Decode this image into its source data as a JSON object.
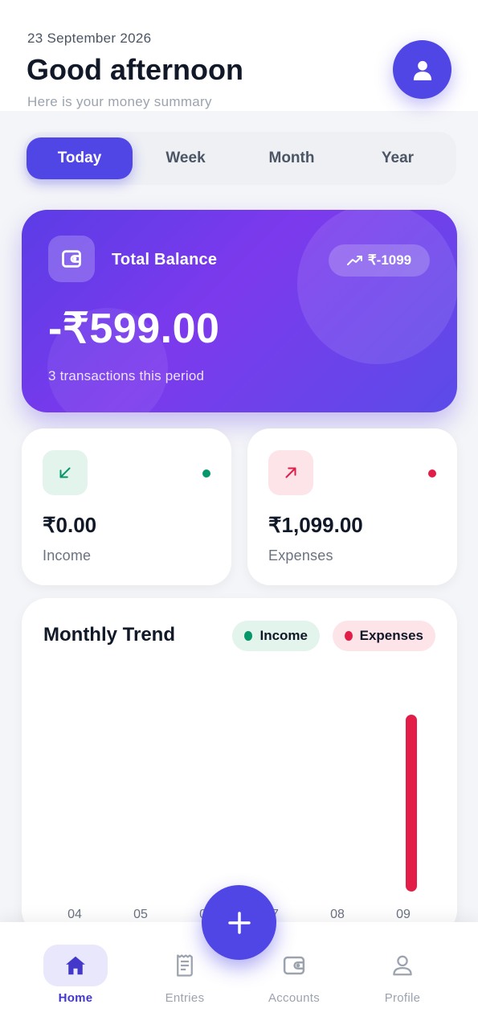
{
  "header": {
    "date": "23 September 2026",
    "greeting": "Good afternoon",
    "subtitle": "Here is your money summary",
    "avatar_icon": "user-icon"
  },
  "tabs": [
    {
      "label": "Today",
      "active": true
    },
    {
      "label": "Week",
      "active": false
    },
    {
      "label": "Month",
      "active": false
    },
    {
      "label": "Year",
      "active": false
    }
  ],
  "balance": {
    "icon": "wallet-icon",
    "title": "Total Balance",
    "trend_icon": "trending-icon",
    "trend_value": "₹-1099",
    "amount": "-₹599.00",
    "transactions": "3 transactions this period"
  },
  "income": {
    "icon": "arrow-down-left-icon",
    "amount": "₹0.00",
    "label": "Income",
    "color": "#059669"
  },
  "expenses": {
    "icon": "arrow-up-right-icon",
    "amount": "₹1,099.00",
    "label": "Expenses",
    "color": "#e11d48"
  },
  "trend": {
    "title": "Monthly Trend",
    "legend_income": "Income",
    "legend_expenses": "Expenses"
  },
  "chart_data": {
    "type": "bar",
    "title": "Monthly Trend",
    "categories": [
      "04",
      "05",
      "06",
      "07",
      "08",
      "09"
    ],
    "series": [
      {
        "name": "Income",
        "values": [
          0,
          0,
          0,
          0,
          0,
          0
        ],
        "color": "#059669"
      },
      {
        "name": "Expenses",
        "values": [
          0,
          0,
          0,
          0,
          0,
          1099
        ],
        "color": "#e11d48"
      }
    ],
    "ylim": [
      0,
      1099
    ],
    "grid": false,
    "legend": "top-right"
  },
  "nav": {
    "items": [
      {
        "label": "Home",
        "icon": "home-icon",
        "active": true
      },
      {
        "label": "Entries",
        "icon": "receipt-icon",
        "active": false
      },
      {
        "label": "Accounts",
        "icon": "wallet-icon",
        "active": false
      },
      {
        "label": "Profile",
        "icon": "user-icon",
        "active": false
      }
    ],
    "fab_icon": "plus-icon"
  },
  "colors": {
    "accent": "#4f46e5",
    "income": "#059669",
    "expenses": "#e11d48",
    "background": "#f4f5f8"
  }
}
